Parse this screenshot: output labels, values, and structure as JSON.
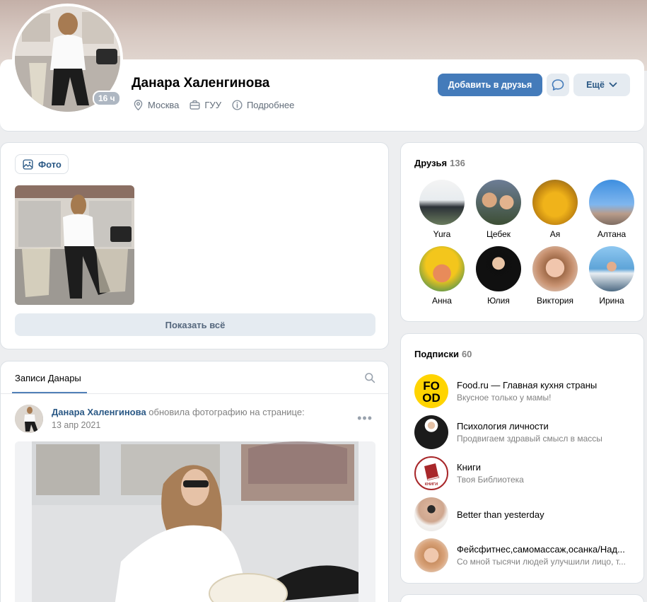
{
  "profile": {
    "name": "Данара Халенгинова",
    "online": "16 ч",
    "city": "Москва",
    "university": "ГУУ",
    "details": "Подробнее"
  },
  "actions": {
    "add_friend": "Добавить в друзья",
    "more": "Ещё"
  },
  "photos": {
    "tab": "Фото",
    "show_all": "Показать всё"
  },
  "wall": {
    "tab": "Записи Данары",
    "post": {
      "author": "Данара Халенгинова",
      "action": " обновила фотографию на странице:",
      "date": "13 апр 2021"
    }
  },
  "friends": {
    "title": "Друзья",
    "count": "136",
    "items": [
      {
        "name": "Yura"
      },
      {
        "name": "Цебек"
      },
      {
        "name": "Ая"
      },
      {
        "name": "Алтана"
      },
      {
        "name": "Анна"
      },
      {
        "name": "Юлия"
      },
      {
        "name": "Виктория"
      },
      {
        "name": "Ирина"
      }
    ]
  },
  "subscriptions": {
    "title": "Подписки",
    "count": "60",
    "items": [
      {
        "name": "Food.ru — Главная кухня страны",
        "desc": "Вкусное только у мамы!",
        "logo_text": "FOOD"
      },
      {
        "name": "Психология личности",
        "desc": "Продвигаем здравый смысл в массы"
      },
      {
        "name": "Книги",
        "desc": "Твоя Библиотека",
        "logo_text": "КНИГИ"
      },
      {
        "name": "Better than yesterday",
        "desc": ""
      },
      {
        "name": "Фейсфитнес,самомассаж,осанка/Над...",
        "desc": "Со мной тысячи людей улучшили лицо, т..."
      }
    ]
  },
  "colors": {
    "accent": "#447bba",
    "link": "#2a5885",
    "secondary_button": "#e5ebf1",
    "page_bg": "#edeef0"
  }
}
